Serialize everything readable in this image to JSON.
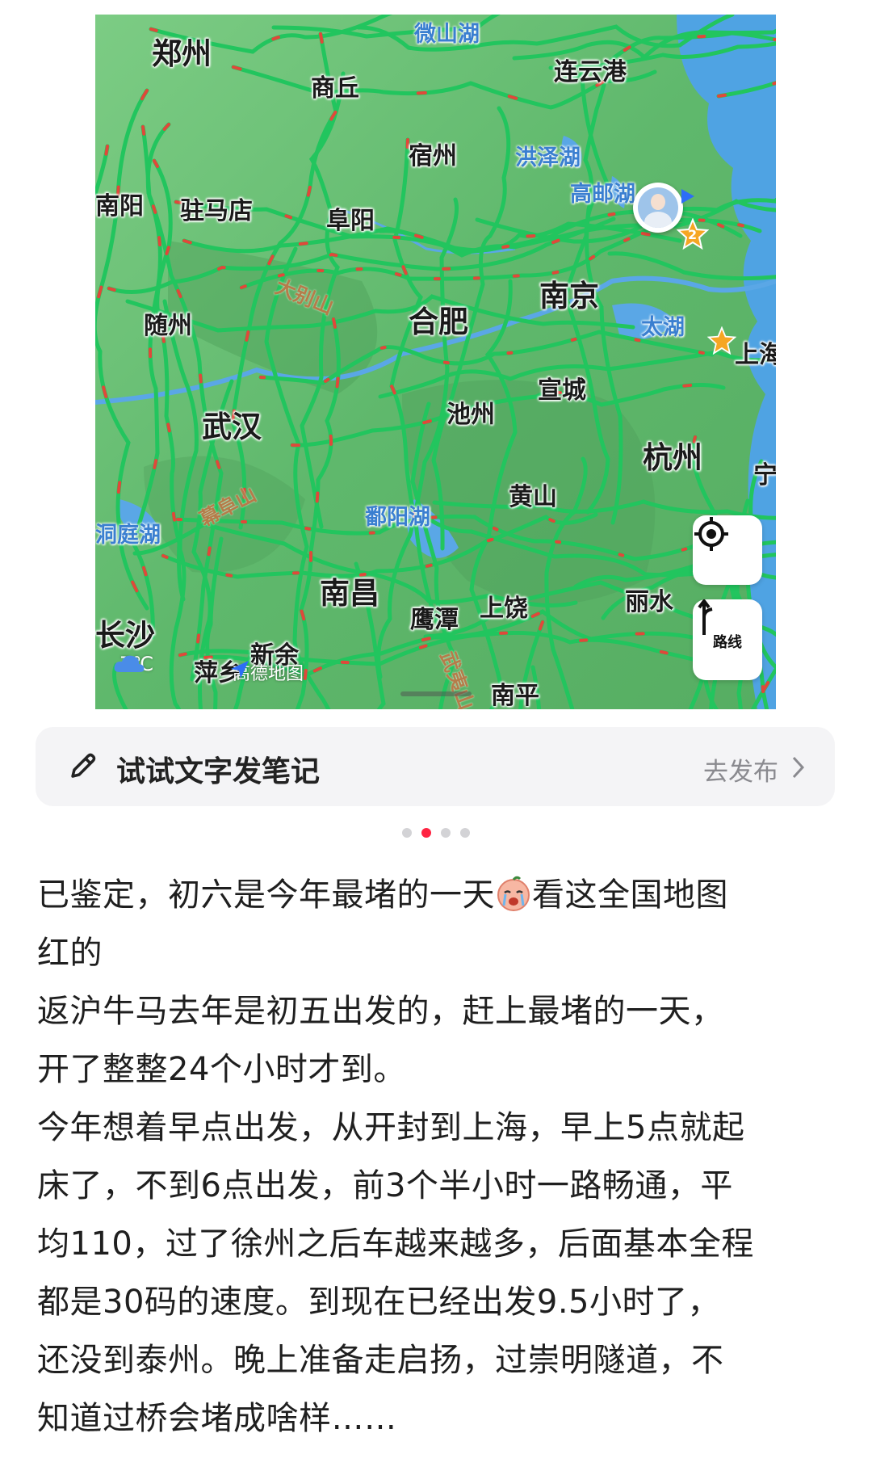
{
  "map": {
    "cities_big": [
      "郑州",
      "合肥",
      "南京",
      "武汉",
      "南昌",
      "杭州",
      "长沙"
    ],
    "cities": [
      "商丘",
      "连云港",
      "宿州",
      "驻马店",
      "阜阳",
      "随州",
      "宣城",
      "池州",
      "黄山",
      "上饶",
      "鹰潭",
      "丽水",
      "南平",
      "新余",
      "萍乡",
      "南阳",
      "上海",
      "宁"
    ],
    "lakes": [
      "微山湖",
      "洪泽湖",
      "高邮湖",
      "太湖",
      "鄱阳湖",
      "洞庭湖"
    ],
    "mountains": [
      "大别山",
      "幕阜山",
      "武夷山"
    ],
    "weather": "7℃",
    "map_brand": "高德地图",
    "badge_count": "2",
    "route_label": "路线",
    "colors": {
      "road": "#22c55e",
      "jam": "#e0483a",
      "land": "#63c072",
      "water": "#5aa7e6"
    }
  },
  "note_bar": {
    "label": "试试文字发笔记",
    "action": "去发布"
  },
  "pager": {
    "count": 4,
    "active": 1
  },
  "post": {
    "lines": [
      "已鉴定，初六是今年最堵的一天",
      "看这全国地图",
      "红的",
      "返沪牛马去年是初五出发的，赶上最堵的一天，",
      "开了整整24个小时才到。",
      "今年想着早点出发，从开封到上海，早上5点就起",
      "床了，不到6点出发，前3个半小时一路畅通，平",
      "均110，过了徐州之后车越来越多，后面基本全程",
      "都是30码的速度。到现在已经出发9.5小时了，",
      "还没到泰州。晚上准备走启扬，过崇明隧道，不",
      "知道过桥会堵成啥样……"
    ]
  }
}
